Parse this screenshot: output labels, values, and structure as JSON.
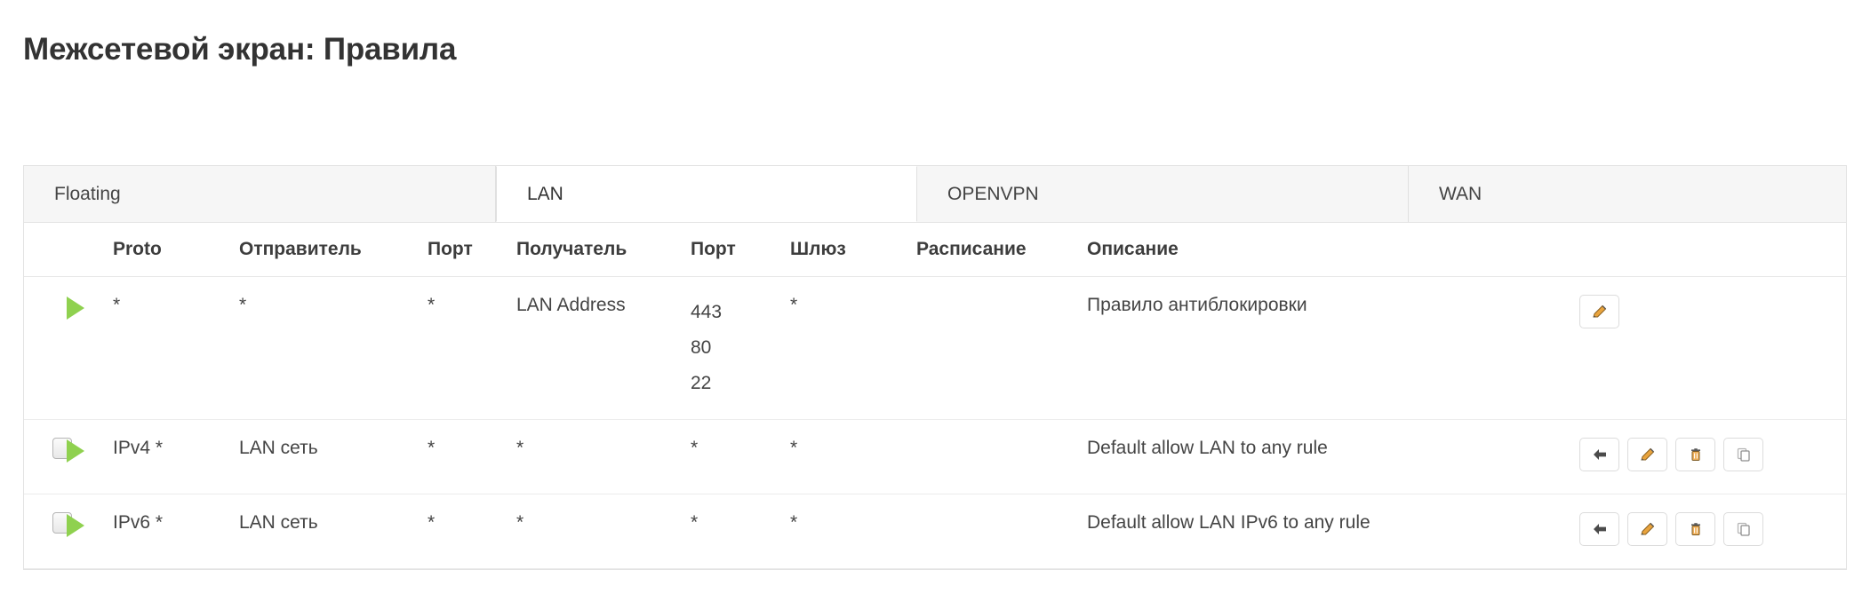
{
  "header": {
    "title": "Межсетевой экран: Правила"
  },
  "tabs": [
    {
      "label": "Floating",
      "active": false
    },
    {
      "label": "LAN",
      "active": true
    },
    {
      "label": "OPENVPN",
      "active": false
    },
    {
      "label": "WAN",
      "active": false
    }
  ],
  "table": {
    "columns": {
      "check": "",
      "state": "",
      "proto": "Proto",
      "source": "Отправитель",
      "source_port": "Порт",
      "destination": "Получатель",
      "dest_port": "Порт",
      "gateway": "Шлюз",
      "schedule": "Расписание",
      "description": "Описание",
      "actions": ""
    },
    "rows": [
      {
        "has_checkbox": false,
        "state_icon": "play-icon",
        "proto": "*",
        "source": "*",
        "source_port": "*",
        "destination": "LAN Address",
        "dest_ports": [
          "443",
          "80",
          "22"
        ],
        "gateway": "*",
        "schedule": "",
        "description": "Правило антиблокировки",
        "actions": [
          "edit-icon"
        ]
      },
      {
        "has_checkbox": true,
        "state_icon": "play-icon",
        "proto": "IPv4 *",
        "source": "LAN сеть",
        "source_port": "*",
        "destination": "*",
        "dest_ports": [
          "*"
        ],
        "gateway": "*",
        "schedule": "",
        "description": "Default allow LAN to any rule",
        "actions": [
          "move-icon",
          "edit-icon",
          "delete-icon",
          "copy-icon"
        ]
      },
      {
        "has_checkbox": true,
        "state_icon": "play-icon",
        "proto": "IPv6 *",
        "source": "LAN сеть",
        "source_port": "*",
        "destination": "*",
        "dest_ports": [
          "*"
        ],
        "gateway": "*",
        "schedule": "",
        "description": "Default allow LAN IPv6 to any rule",
        "actions": [
          "move-icon",
          "edit-icon",
          "delete-icon",
          "copy-icon"
        ]
      }
    ]
  },
  "colors": {
    "pass_green": "#8fd14f",
    "icon_orange": "#e8a33d",
    "text": "#3d3d3d",
    "border": "#e3e3e3",
    "stripe": "#fafafa"
  }
}
